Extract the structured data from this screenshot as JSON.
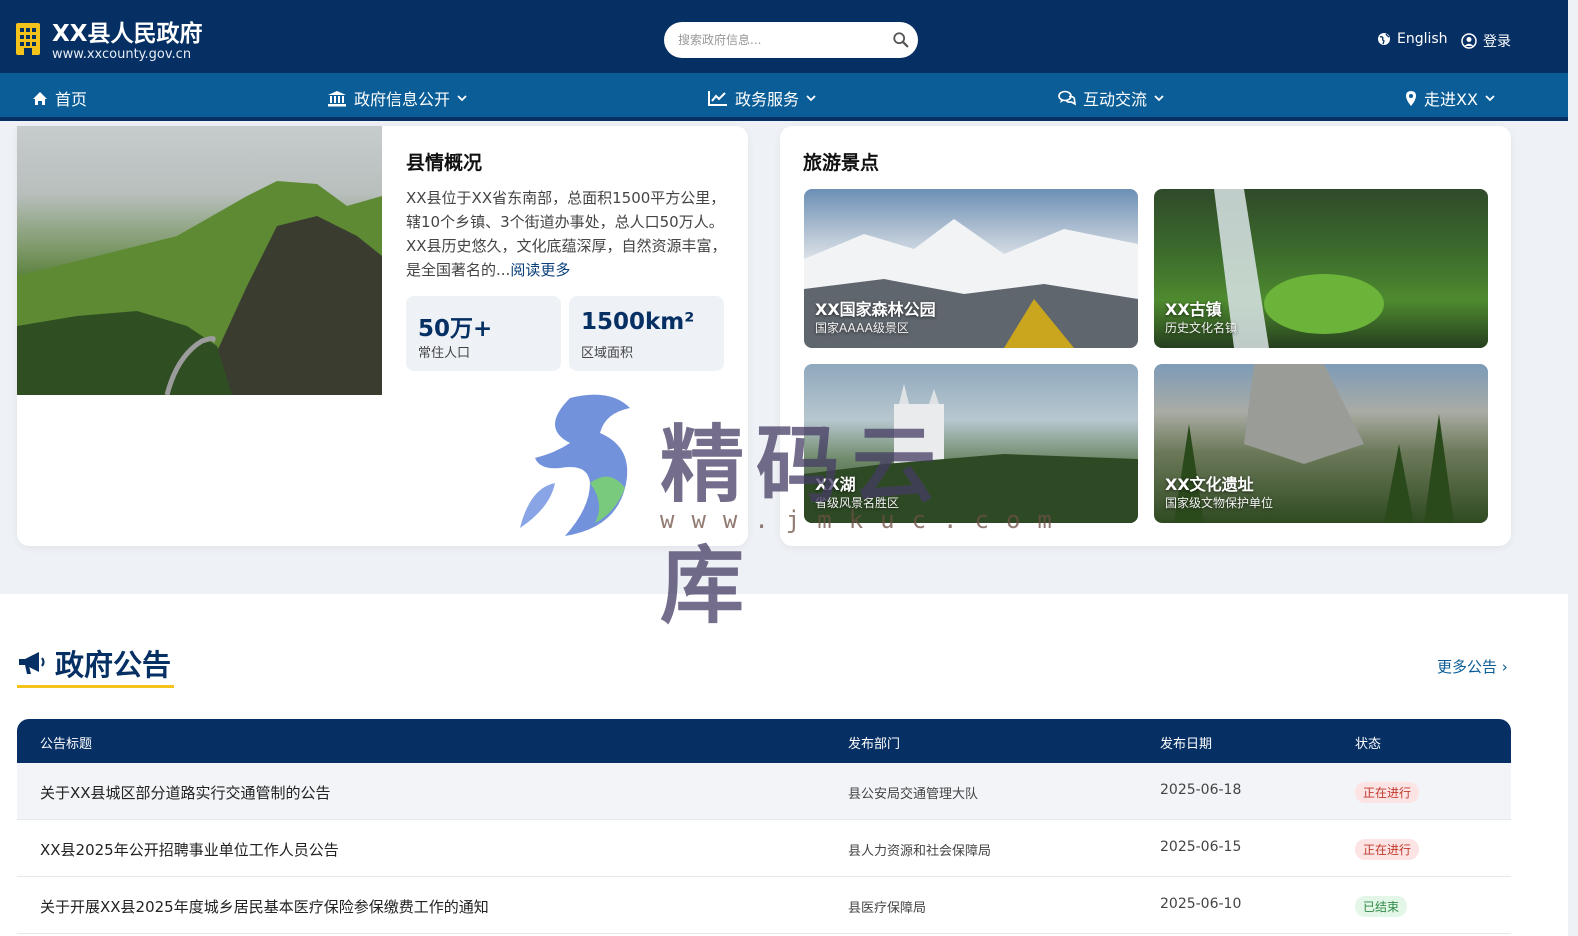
{
  "header": {
    "site_title": "XX县人民政府",
    "site_url": "www.xxcounty.gov.cn",
    "search_placeholder": "搜索政府信息...",
    "lang_label": "English",
    "login_label": "登录"
  },
  "nav": {
    "items": [
      {
        "label": "首页",
        "icon": "home-icon"
      },
      {
        "label": "政府信息公开",
        "icon": "bank-icon"
      },
      {
        "label": "政务服务",
        "icon": "chart-icon"
      },
      {
        "label": "互动交流",
        "icon": "chat-icon"
      },
      {
        "label": "走进XX",
        "icon": "location-icon"
      }
    ]
  },
  "overview": {
    "title": "县情概况",
    "desc": "XX县位于XX省东南部，总面积1500平方公里，辖10个乡镇、3个街道办事处，总人口50万人。XX县历史悠久，文化底蕴深厚，自然资源丰富，是全国著名的...",
    "read_more": "阅读更多",
    "stats": [
      {
        "value": "50万+",
        "label": "常住人口"
      },
      {
        "value": "1500km²",
        "label": "区域面积"
      }
    ]
  },
  "tourism": {
    "title": "旅游景点",
    "spots": [
      {
        "name": "XX国家森林公园",
        "sub": "国家AAAA级景区"
      },
      {
        "name": "XX古镇",
        "sub": "历史文化名镇"
      },
      {
        "name": "XX湖",
        "sub": "省级风景名胜区"
      },
      {
        "name": "XX文化遗址",
        "sub": "国家级文物保护单位"
      }
    ]
  },
  "notices": {
    "title": "政府公告",
    "more": "更多公告",
    "columns": [
      "公告标题",
      "发布部门",
      "发布日期",
      "状态"
    ],
    "rows": [
      {
        "title": "关于XX县城区部分道路实行交通管制的公告",
        "dept": "县公安局交通管理大队",
        "date": "2025-06-18",
        "status": "正在进行"
      },
      {
        "title": "XX县2025年公开招聘事业单位工作人员公告",
        "dept": "县人力资源和社会保障局",
        "date": "2025-06-15",
        "status": "正在进行"
      },
      {
        "title": "关于开展XX县2025年度城乡居民基本医疗保险参保缴费工作的通知",
        "dept": "县医疗保障局",
        "date": "2025-06-10",
        "status": "已结束"
      }
    ]
  },
  "watermark": {
    "text": "精码云库",
    "url": "www.jmkuc.com"
  },
  "colors": {
    "primary": "#062f63",
    "nav": "#0a5d96",
    "accent": "#f3c21b"
  }
}
